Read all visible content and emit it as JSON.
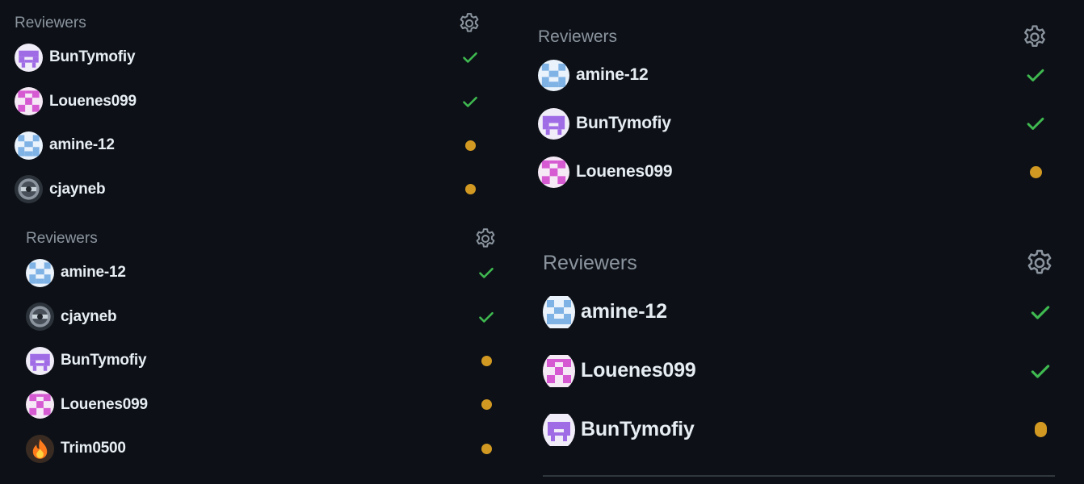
{
  "colors": {
    "background": "#0d1117",
    "text": "#e6edf3",
    "muted": "#8b949e",
    "approved": "#3fb950",
    "pending": "#d29922",
    "divider": "#30363d"
  },
  "panels": [
    {
      "title": "Reviewers",
      "reviewers": [
        {
          "name": "BunTymofiy",
          "status": "approved"
        },
        {
          "name": "Louenes099",
          "status": "approved"
        },
        {
          "name": "amine-12",
          "status": "pending"
        },
        {
          "name": "cjayneb",
          "status": "pending"
        }
      ]
    },
    {
      "title": "Reviewers",
      "reviewers": [
        {
          "name": "amine-12",
          "status": "approved"
        },
        {
          "name": "cjayneb",
          "status": "approved"
        },
        {
          "name": "BunTymofiy",
          "status": "pending"
        },
        {
          "name": "Louenes099",
          "status": "pending"
        },
        {
          "name": "Trim0500",
          "status": "pending"
        }
      ]
    },
    {
      "title": "Reviewers",
      "reviewers": [
        {
          "name": "amine-12",
          "status": "approved"
        },
        {
          "name": "BunTymofiy",
          "status": "approved"
        },
        {
          "name": "Louenes099",
          "status": "pending"
        }
      ]
    },
    {
      "title": "Reviewers",
      "reviewers": [
        {
          "name": "amine-12",
          "status": "approved"
        },
        {
          "name": "Louenes099",
          "status": "approved"
        },
        {
          "name": "BunTymofiy",
          "status": "pending"
        }
      ]
    }
  ],
  "icons": {
    "settings": "gear-icon",
    "approved": "check-icon",
    "pending": "pending-dot-icon"
  },
  "avatars": {
    "BunTymofiy": {
      "icon": "identicon-purple-avatar",
      "color": "#a06ce6"
    },
    "Louenes099": {
      "icon": "identicon-pink-avatar",
      "color": "#d65ad2"
    },
    "amine-12": {
      "icon": "identicon-blue-avatar",
      "color": "#7fb2e5"
    },
    "cjayneb": {
      "icon": "photo-avatar-grey",
      "color": "#6e7681"
    },
    "Trim0500": {
      "icon": "fire-avatar",
      "color": "#ff7b1c"
    }
  }
}
